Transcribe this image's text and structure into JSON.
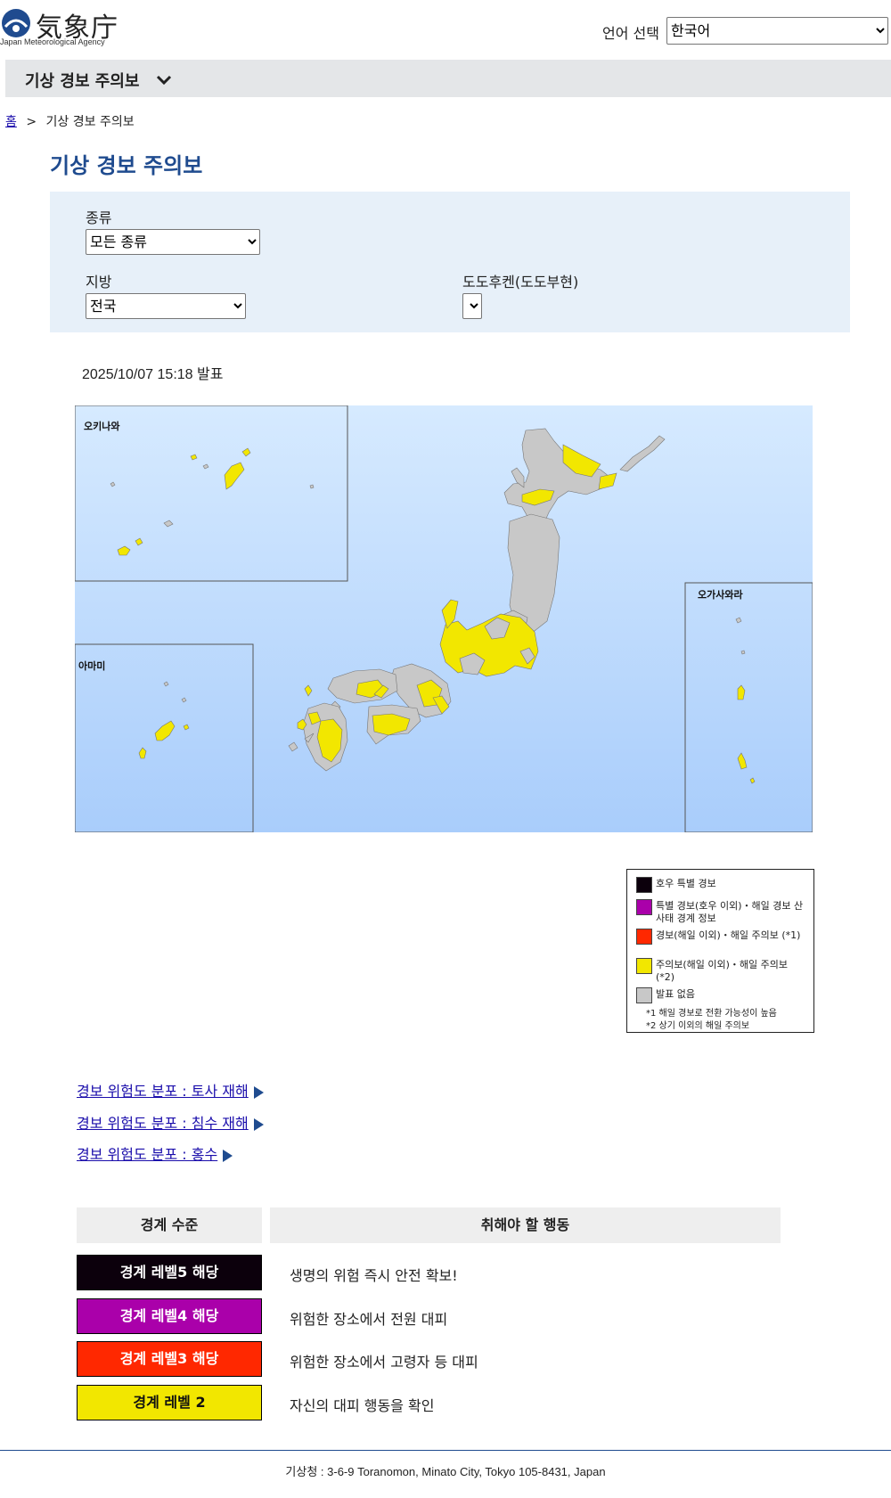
{
  "header": {
    "logo_text": "気象庁",
    "logo_subtitle": "Japan Meteorological Agency",
    "language_label": "언어 선택",
    "language_value": "한국어"
  },
  "nav": {
    "title": "기상 경보 주의보"
  },
  "breadcrumb": {
    "home": "홈",
    "separator": ">",
    "current": "기상 경보 주의보"
  },
  "page_title": "기상 경보 주의보",
  "filters": {
    "type_label": "종류",
    "type_value": "모든 종류",
    "region_label": "지방",
    "region_value": "전국",
    "prefecture_label": "도도후켄(도도부현)",
    "prefecture_value": ""
  },
  "issued": "2025/10/07 15:18 발표",
  "map": {
    "insets": {
      "okinawa": "오키나와",
      "amami": "아마미",
      "ogasawara": "오가사와라"
    }
  },
  "legend": {
    "items": [
      {
        "label": "호우 특별 경보",
        "color": "#0c000c"
      },
      {
        "label": "특별 경보(호우 이외)・해일 경보 산사태 경계 정보",
        "color": "#aa00aa"
      },
      {
        "label": "경보(해일 이외)・해일 주의보 (*1)",
        "color": "#ff2800"
      },
      {
        "label": "주의보(해일 이외)・해일 주의보 (*2)",
        "color": "#f2e700"
      },
      {
        "label": "발표 없음",
        "color": "#c8c8c8"
      }
    ],
    "note1": "*1 해일 경보로 전환 가능성이 높음",
    "note2": "*2 상기 이외의 해일 주의보"
  },
  "links": [
    "경보 위험도 분포 : 토사 재해",
    "경보 위험도 분포 : 침수 재해",
    "경보 위험도 분포 : 홍수"
  ],
  "levels": {
    "header_level": "경계 수준",
    "header_action": "취해야 할 행동",
    "rows": [
      {
        "level": "경계 레벨5 해당",
        "action": "생명의 위험 즉시 안전 확보!",
        "color": "#0c000c"
      },
      {
        "level": "경계 레벨4 해당",
        "action": "위험한 장소에서 전원 대피",
        "color": "#aa00aa"
      },
      {
        "level": "경계 레벨3 해당",
        "action": "위험한 장소에서 고령자 등 대피",
        "color": "#ff2800"
      },
      {
        "level": "경계 레벨 2",
        "action": "자신의 대피 행동을 확인",
        "color": "#f2e700"
      }
    ]
  },
  "footer": "기상청 : 3-6-9 Toranomon, Minato City, Tokyo 105-8431, Japan"
}
